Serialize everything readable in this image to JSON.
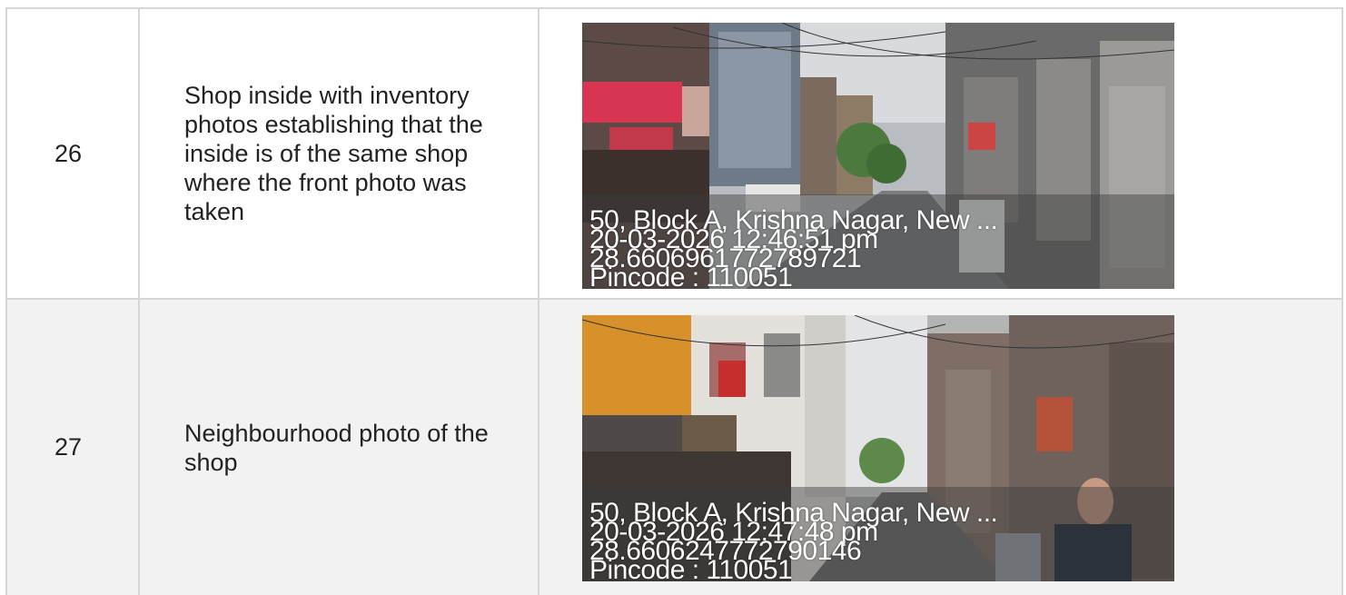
{
  "rows": [
    {
      "number": "26",
      "description": "Shop inside with inventory photos establishing that the inside is of the same shop where the front photo was taken",
      "photo": {
        "address": "50, Block A, Krishna Nagar, New ...",
        "datetime": "20-03-2026 12:46:51 pm",
        "coordinates": "28.6606961772789721",
        "pincode": "Pincode : 110051"
      }
    },
    {
      "number": "27",
      "description": "Neighbourhood photo of the shop",
      "photo": {
        "address": "50, Block A, Krishna Nagar, New ...",
        "datetime": "20-03-2026 12:47:48 pm",
        "coordinates": "28.6606247772790146",
        "pincode": "Pincode : 110051"
      }
    }
  ]
}
